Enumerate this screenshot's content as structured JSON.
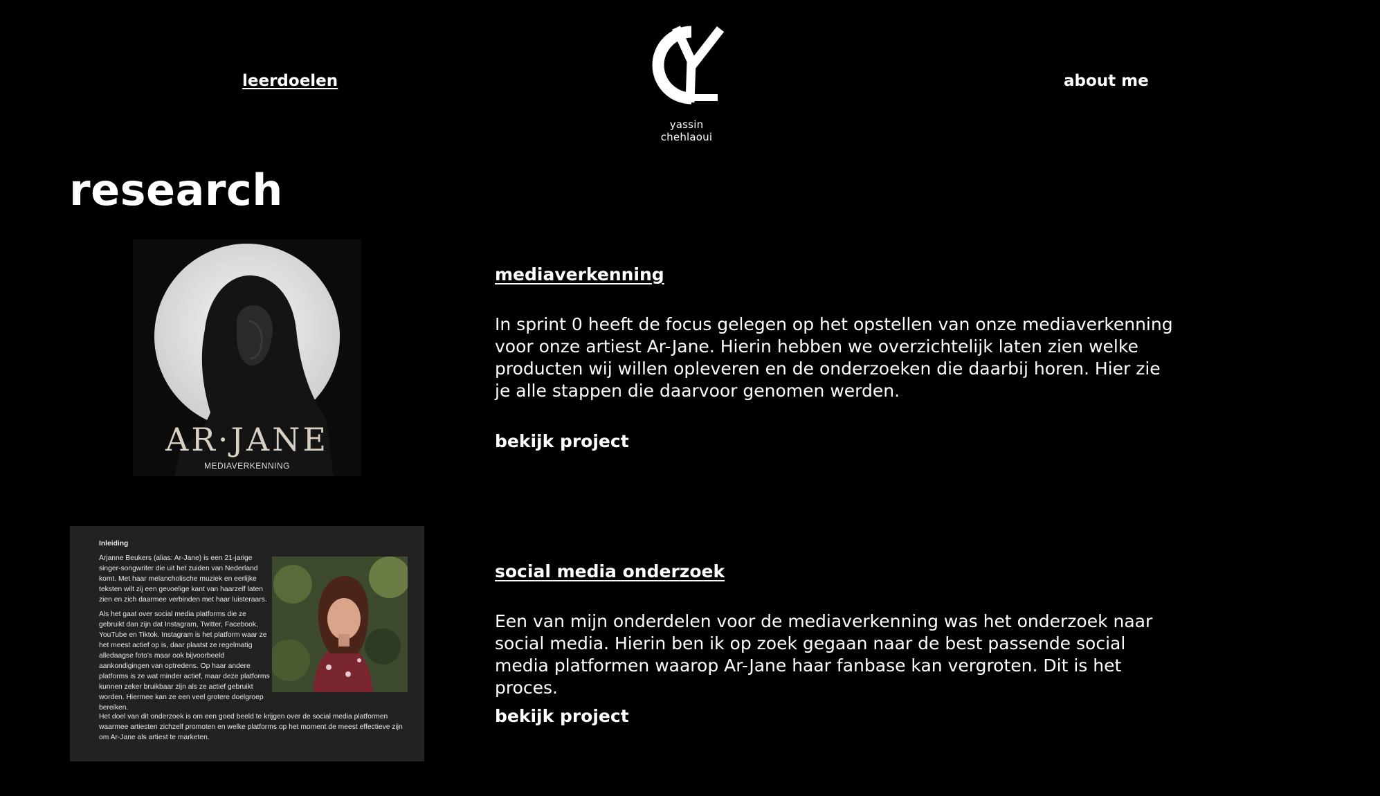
{
  "nav": {
    "left_label": "leerdoelen",
    "right_label": "about me"
  },
  "logo": {
    "name": "yassin chehlaoui"
  },
  "page": {
    "title": "research"
  },
  "projects": [
    {
      "title": "mediaverkenning",
      "description": "In sprint 0 heeft de focus gelegen op het opstellen van onze mediaverkenning voor onze artiest Ar-Jane. Hierin hebben we overzichtelijk laten zien welke producten wij willen opleveren en de onderzoeken die daarbij horen. Hier zie je alle stappen die daarvoor genomen werden.",
      "link": "bekijk project",
      "thumb": {
        "name": "AR·JANE",
        "sub": "MEDIAVERKENNING"
      }
    },
    {
      "title": "social media onderzoek",
      "description": "Een van mijn onderdelen voor de mediaverkenning was het onderzoek naar social media. Hierin ben ik op zoek gegaan naar de best passende social media platformen waarop Ar-Jane haar fanbase kan vergroten. Dit is het proces.",
      "link": "bekijk project",
      "thumb": {
        "heading": "Inleiding",
        "para1": "Arjanne Beukers (alias: Ar-Jane) is een 21-jarige singer-songwriter die uit het zuiden van Nederland komt. Met haar melancholische muziek en eerlijke teksten wilt zij een gevoelige kant van haarzelf laten zien en zich daarmee verbinden met haar luisteraars.",
        "para2": "Als het gaat over social media platforms die ze gebruikt dan zijn dat Instagram, Twitter, Facebook, YouTube en Tiktok. Instagram is het platform waar ze het meest actief op is, daar plaatst ze regelmatig alledaagse foto's maar ook bijvoorbeeld aankondigingen van optredens. Op haar andere platforms is ze wat minder actief, maar deze platforms kunnen zeker bruikbaar zijn als ze actief gebruikt worden. Hiermee kan ze een veel grotere doelgroep bereiken.",
        "para3": "Het doel van dit onderzoek is om een goed beeld te krijgen over de social media platformen waarmee artiesten zichzelf promoten en welke platforms op het moment de meest effectieve zijn om Ar-Jane als artiest te marketen."
      }
    }
  ]
}
